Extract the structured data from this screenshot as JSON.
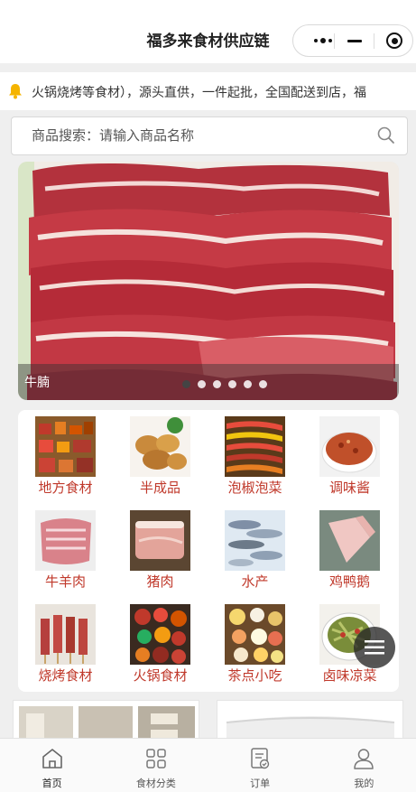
{
  "header": {
    "title": "福多来食材供应链",
    "more_icon": "more-dots-icon",
    "minimize_icon": "minimize-icon",
    "close_icon": "target-close-icon"
  },
  "notice": {
    "icon": "bell-icon",
    "text": "火锅烧烤等食材），源头直供，一件起批，全国配送到店，福"
  },
  "search": {
    "placeholder": "商品搜索：请输入商品名称",
    "icon": "search-icon"
  },
  "banner": {
    "caption": "牛腩",
    "slide_count": 6,
    "active_index": 0
  },
  "categories": [
    {
      "label": "地方食材"
    },
    {
      "label": "半成品"
    },
    {
      "label": "泡椒泡菜"
    },
    {
      "label": "调味酱"
    },
    {
      "label": "牛羊肉"
    },
    {
      "label": "猪肉"
    },
    {
      "label": "水产"
    },
    {
      "label": "鸡鸭鹅"
    },
    {
      "label": "烧烤食材"
    },
    {
      "label": "火锅食材"
    },
    {
      "label": "茶点小吃"
    },
    {
      "label": "卤味凉菜"
    }
  ],
  "colors": {
    "category_label": "#c0392b",
    "bell": "#f5b400"
  },
  "tabbar": {
    "items": [
      {
        "label": "首页",
        "icon": "home-icon",
        "active": true
      },
      {
        "label": "食材分类",
        "icon": "category-grid-icon",
        "active": false
      },
      {
        "label": "订单",
        "icon": "order-icon",
        "active": false
      },
      {
        "label": "我的",
        "icon": "user-icon",
        "active": false
      }
    ]
  }
}
